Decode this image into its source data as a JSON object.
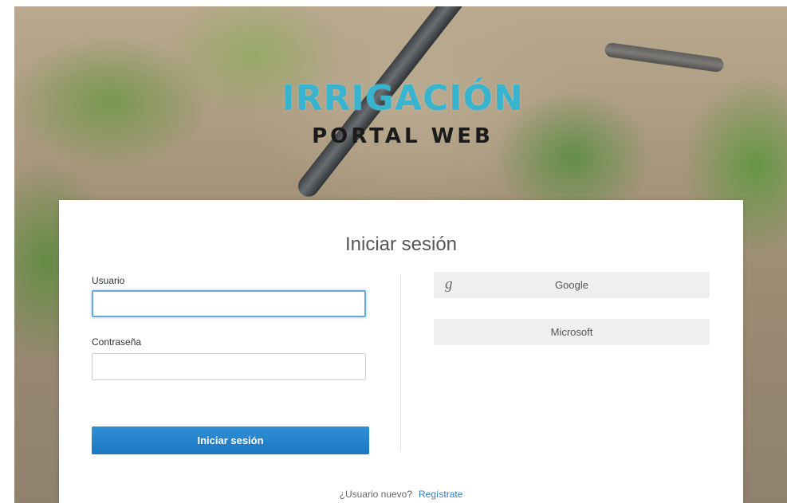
{
  "logo": {
    "brand": "IRRIGACIÓN",
    "subtitle": "PORTAL WEB"
  },
  "login": {
    "title": "Iniciar sesión",
    "username_label": "Usuario",
    "username_value": "",
    "password_label": "Contraseña",
    "password_value": "",
    "submit_label": "Iniciar sesión"
  },
  "social": {
    "google_label": "Google",
    "google_icon": "g-icon",
    "microsoft_label": "Microsoft"
  },
  "footer": {
    "new_user_text": "¿Usuario nuevo?",
    "register_link": "Regístrate"
  },
  "colors": {
    "brand": "#39b4cf",
    "primary_button": "#1f7cc4",
    "link": "#2a7dc3"
  }
}
